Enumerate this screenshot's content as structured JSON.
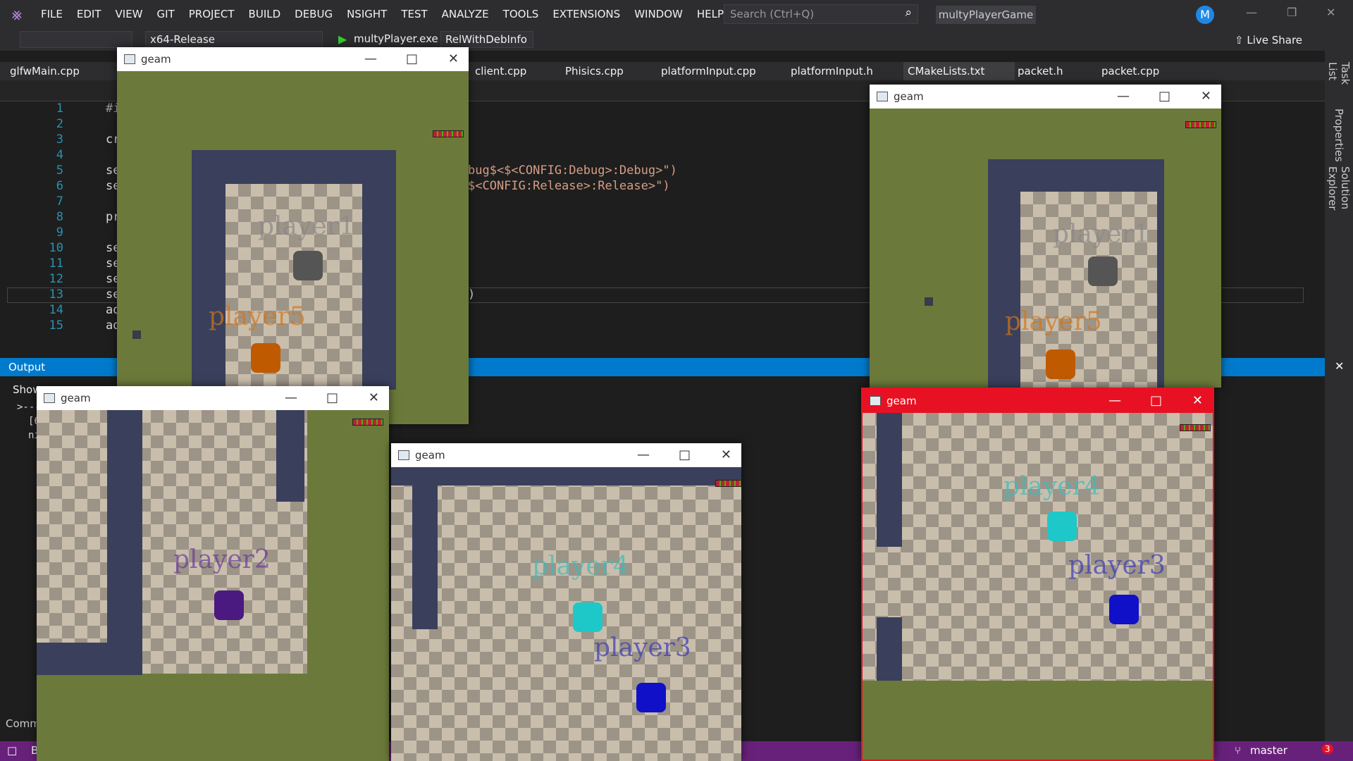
{
  "menubar": {
    "items": [
      "FILE",
      "EDIT",
      "VIEW",
      "GIT",
      "PROJECT",
      "BUILD",
      "DEBUG",
      "NSIGHT",
      "TEST",
      "ANALYZE",
      "TOOLS",
      "EXTENSIONS",
      "WINDOW",
      "HELP"
    ],
    "search_placeholder": "Search (Ctrl+Q)",
    "solution": "multyPlayerGame",
    "avatar": "M"
  },
  "toolbar": {
    "platform": "x64-Release",
    "target": "multyPlayer.exe",
    "config": "RelWithDebInfo",
    "live_share": "Live Share"
  },
  "tabs": [
    "glfwMain.cpp",
    "client.cpp",
    "Phisics.cpp",
    "platformInput.cpp",
    "platformInput.h",
    "CMakeLists.txt",
    "packet.h",
    "packet.cpp"
  ],
  "editor": {
    "lines": [
      "1",
      "2",
      "3",
      "4",
      "5",
      "6",
      "7",
      "8",
      "9",
      "10",
      "11",
      "12",
      "13",
      "14",
      "15"
    ],
    "prefixes": [
      "#i",
      "",
      "cr",
      "",
      "se",
      "se",
      "",
      "pr",
      "",
      "se",
      "se",
      "se",
      "se",
      "ad",
      "ad"
    ],
    "visible_code": [
      "bug$<$<CONFIG:Debug>:Debug>\")",
      "$<CONFIG:Release>:Release>\")",
      ")"
    ]
  },
  "side_tabs": [
    "Task List",
    "Properties",
    "Solution Explorer"
  ],
  "output": {
    "title": "Output",
    "show_label": "Show",
    "lines": [
      ">---",
      "[6",
      "ni"
    ],
    "command": "Comm"
  },
  "status": {
    "branch": "master",
    "notif": "3",
    "left": "B"
  },
  "game_windows": [
    {
      "title": "geam",
      "players": [
        {
          "name": "player1",
          "color": "#555555"
        },
        {
          "name": "player5",
          "color": "#c05a00"
        }
      ]
    },
    {
      "title": "geam",
      "players": [
        {
          "name": "player1",
          "color": "#555555"
        },
        {
          "name": "player5",
          "color": "#c05a00"
        }
      ]
    },
    {
      "title": "geam",
      "players": [
        {
          "name": "player2",
          "color": "#4b1a80"
        }
      ]
    },
    {
      "title": "geam",
      "players": [
        {
          "name": "player4",
          "color": "#1ec8c8"
        },
        {
          "name": "player3",
          "color": "#1010c8"
        }
      ]
    },
    {
      "title": "geam",
      "players": [
        {
          "name": "player4",
          "color": "#1ec8c8"
        },
        {
          "name": "player3",
          "color": "#1010c8"
        }
      ]
    }
  ]
}
